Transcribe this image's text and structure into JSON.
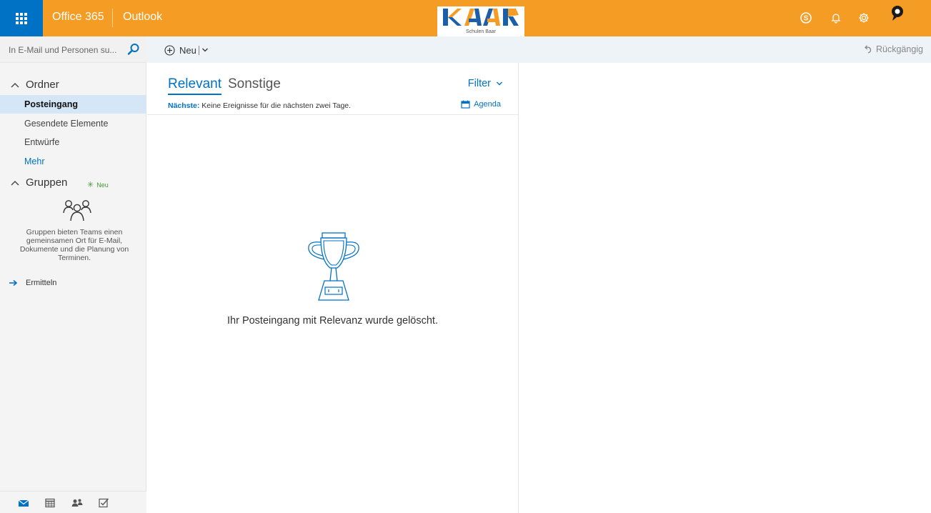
{
  "topbar": {
    "brand": "Office 365",
    "app_name": "Outlook",
    "logo_caption": "Schulen Baar",
    "colors": {
      "bar": "#f59c24",
      "waffle": "#0072c6"
    },
    "icons": [
      "app-launcher-icon",
      "skype-icon",
      "bell-icon",
      "gear-icon",
      "help-icon"
    ]
  },
  "search": {
    "placeholder": "In E-Mail und Personen su..."
  },
  "nav": {
    "folders_heading": "Ordner",
    "folders": [
      {
        "label": "Posteingang",
        "selected": true
      },
      {
        "label": "Gesendete Elemente",
        "selected": false
      },
      {
        "label": "Entwürfe",
        "selected": false
      }
    ],
    "more": "Mehr",
    "groups_heading": "Gruppen",
    "groups_badge": "Neu",
    "groups_text": "Gruppen bieten Teams einen gemeinsamen Ort für E-Mail, Dokumente und die Planung von Terminen.",
    "discover": "Ermitteln",
    "bottom_icons": [
      "mail-icon",
      "calendar-icon",
      "people-icon",
      "tasks-icon"
    ]
  },
  "commandbar": {
    "new_label": "Neu",
    "undo_label": "Rückgängig"
  },
  "list": {
    "tabs": [
      "Relevant",
      "Sonstige"
    ],
    "active_tab": "Relevant",
    "filter_label": "Filter",
    "next_label": "Nächste:",
    "next_text": "Keine Ereignisse für die nächsten zwei Tage.",
    "agenda_label": "Agenda",
    "empty_message": "Ihr Posteingang mit Relevanz wurde gelöscht."
  }
}
